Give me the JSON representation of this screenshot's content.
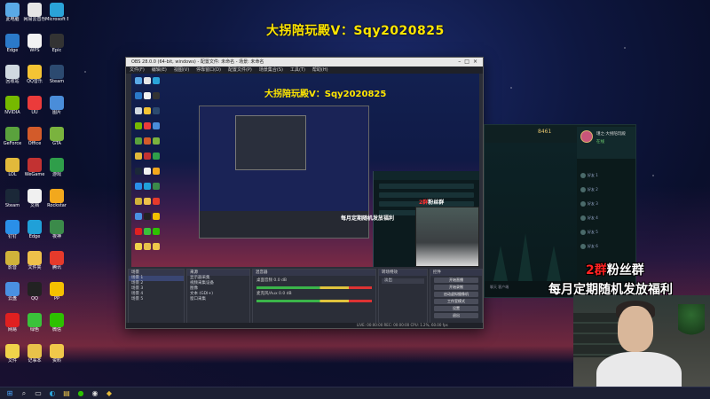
{
  "stream": {
    "title": "大拐陪玩殿V：Sqy2020825"
  },
  "desktop": {
    "icons": [
      {
        "label": "此电脑",
        "icon": "computer-icon",
        "color": "#5aa9e6"
      },
      {
        "label": "网易云音乐",
        "icon": "app-icon",
        "color": "#e6e6e6"
      },
      {
        "label": "Microsoft Edge",
        "icon": "edge-icon",
        "color": "#2aa3d8"
      },
      {
        "label": "Edge",
        "icon": "app-icon",
        "color": "#2b79c9"
      },
      {
        "label": "WPS",
        "icon": "doc-icon",
        "color": "#f2f2f2"
      },
      {
        "label": "Epic",
        "icon": "game-icon",
        "color": "#333333"
      },
      {
        "label": "回收站",
        "icon": "recycle-bin-icon",
        "color": "#d0d8e0"
      },
      {
        "label": "QQ音乐",
        "icon": "app-icon",
        "color": "#f4c434"
      },
      {
        "label": "Steam",
        "icon": "steam-icon",
        "color": "#2c4a70"
      },
      {
        "label": "NVIDIA",
        "icon": "nvidia-icon",
        "color": "#76b900"
      },
      {
        "label": "UU",
        "icon": "app-icon",
        "color": "#eb3b3b"
      },
      {
        "label": "图片",
        "icon": "folder-icon",
        "color": "#4a8dd9"
      },
      {
        "label": "GeForce",
        "icon": "app-icon",
        "color": "#5aa23d"
      },
      {
        "label": "Office",
        "icon": "app-icon",
        "color": "#d35b2a"
      },
      {
        "label": "GTA",
        "icon": "game-icon",
        "color": "#7ab33e"
      },
      {
        "label": "LOL",
        "icon": "lol-icon",
        "color": "#e2b93b"
      },
      {
        "label": "WeGame",
        "icon": "app-icon",
        "color": "#c23232"
      },
      {
        "label": "游戏",
        "icon": "game-icon",
        "color": "#2f9e4a"
      },
      {
        "label": "Steam",
        "icon": "steam-icon",
        "color": "#1b2838"
      },
      {
        "label": "文档",
        "icon": "doc-icon",
        "color": "#f0f0f0"
      },
      {
        "label": "Rockstar",
        "icon": "game-icon",
        "color": "#f2a81d"
      },
      {
        "label": "钉钉",
        "icon": "app-icon",
        "color": "#2a8fe8"
      },
      {
        "label": "Edge",
        "icon": "edge-icon",
        "color": "#20a0d8"
      },
      {
        "label": "夜神",
        "icon": "app-icon",
        "color": "#3b8a4a"
      },
      {
        "label": "影音",
        "icon": "app-icon",
        "color": "#d0b23a"
      },
      {
        "label": "文件夹",
        "icon": "folder-icon",
        "color": "#eec04a"
      },
      {
        "label": "腾讯",
        "icon": "app-icon",
        "color": "#e63a2b"
      },
      {
        "label": "云盘",
        "icon": "cloud-icon",
        "color": "#4a90e2"
      },
      {
        "label": "QQ",
        "icon": "qq-icon",
        "color": "#222222"
      },
      {
        "label": "PP",
        "icon": "app-icon",
        "color": "#f4c000"
      },
      {
        "label": "网易",
        "icon": "app-icon",
        "color": "#e02020"
      },
      {
        "label": "绿色",
        "icon": "app-icon",
        "color": "#3ac23a"
      },
      {
        "label": "微信",
        "icon": "wechat-icon",
        "color": "#2dc100"
      },
      {
        "label": "文件",
        "icon": "folder-icon",
        "color": "#f0d24a"
      },
      {
        "label": "记事本",
        "icon": "doc-icon",
        "color": "#e8c24a"
      },
      {
        "label": "资料",
        "icon": "folder-icon",
        "color": "#f0c84a"
      }
    ]
  },
  "obs": {
    "title": "OBS 28.0.0 (64-bit, windows) - 配置文件: 未命名 - 场景: 未命名",
    "menu": [
      "文件(F)",
      "编辑(E)",
      "视图(V)",
      "停靠窗口(D)",
      "配置文件(P)",
      "场景集合(S)",
      "工具(T)",
      "帮助(H)"
    ],
    "preview_title": "大拐陪玩殿V：Sqy2020825",
    "docks": {
      "scenes_title": "场景",
      "scenes": [
        "场景 1",
        "场景 2",
        "场景 3",
        "场景 4",
        "场景 5"
      ],
      "sources_title": "来源",
      "sources": [
        "显示器采集",
        "视频采集设备",
        "图像",
        "文本 (GDI+)",
        "窗口采集"
      ],
      "mixer_title": "混音器",
      "mixer": [
        {
          "label": "桌面音频",
          "db": "0.0 dB"
        },
        {
          "label": "麦克风/Aux",
          "db": "0.0 dB"
        }
      ],
      "transitions_title": "转场特效",
      "transition_value": "淡出",
      "controls_title": "控件",
      "controls": [
        "开始直播",
        "开始录制",
        "启动虚拟摄像机",
        "工作室模式",
        "设置",
        "退出"
      ]
    },
    "status": "LIVE: 00:00:00  REC: 00:00:00  CPU: 1.2%, 60.00 fps"
  },
  "client": {
    "gold": "8461",
    "profile_name": "瑾之·大拐陪玩殿",
    "status": "在线",
    "friends": [
      "好友 1",
      "好友 2",
      "好友 3",
      "好友 4",
      "好友 5",
      "好友 6"
    ],
    "bottom": "聊天   客户端"
  },
  "overlay": {
    "fan_num": "2群",
    "fan_text": "粉丝群",
    "fan_line2": "每月定期随机发放福利",
    "small_fan_num": "2群",
    "small_fan_text": "粉丝群",
    "small_fan_line2": "每月定期随机发放福利"
  },
  "taskbar": {
    "icons": [
      "windows-start-icon",
      "search-icon",
      "task-view-icon",
      "edge-icon",
      "explorer-icon",
      "wechat-icon",
      "obs-icon",
      "lol-icon"
    ]
  }
}
